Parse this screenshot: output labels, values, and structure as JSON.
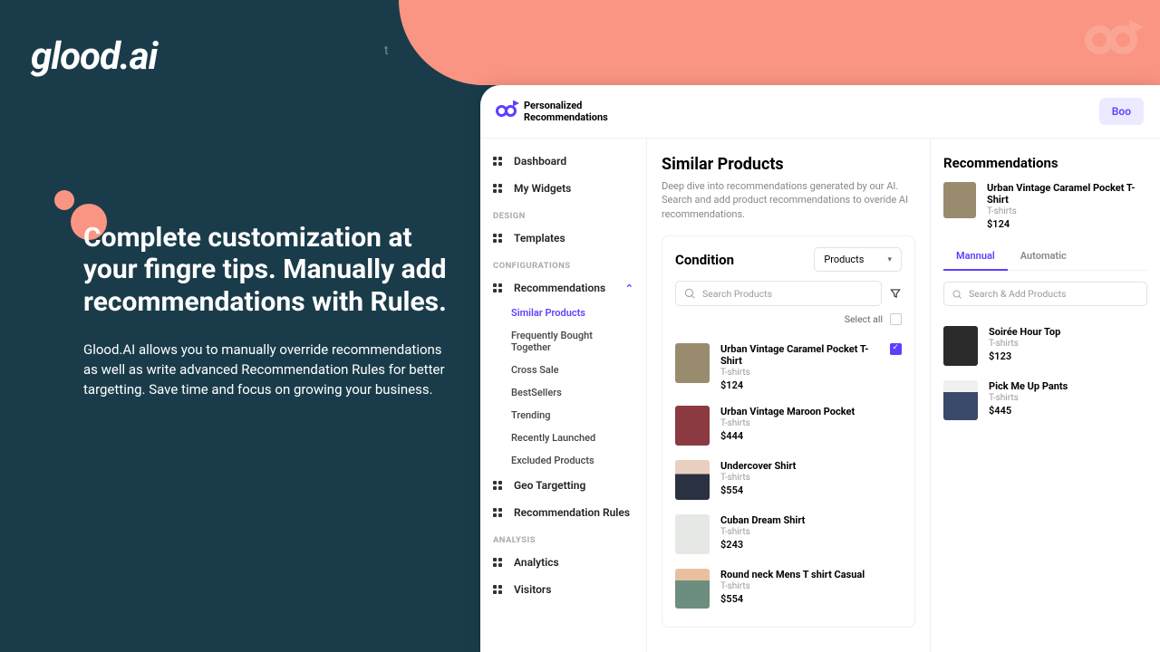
{
  "marketing": {
    "logo": "glood.ai",
    "stray_char": "t",
    "headline": "Complete customization at your fingre tips. Manually add recommendations with Rules.",
    "body": "Glood.AI allows you to manually override recommendations as well as write advanced Recommendation Rules for better targetting. Save time and focus on growing your business."
  },
  "app": {
    "header": {
      "title_line1": "Personalized",
      "title_line2": "Recommendations",
      "cta": "Boo"
    },
    "nav": {
      "items_top": [
        {
          "label": "Dashboard"
        },
        {
          "label": "My Widgets"
        }
      ],
      "section_design": "DESIGN",
      "design_items": [
        {
          "label": "Templates"
        }
      ],
      "section_config": "CONFIGURATIONS",
      "recommendations_label": "Recommendations",
      "rec_children": [
        {
          "label": "Similar Products",
          "active": true
        },
        {
          "label": "Frequently Bought Together"
        },
        {
          "label": "Cross Sale"
        },
        {
          "label": "BestSellers"
        },
        {
          "label": "Trending"
        },
        {
          "label": "Recently Launched"
        },
        {
          "label": "Excluded Products"
        }
      ],
      "config_items": [
        {
          "label": "Geo Targetting"
        },
        {
          "label": "Recommendation Rules"
        }
      ],
      "section_analysis": "ANALYSIS",
      "analysis_items": [
        {
          "label": "Analytics"
        },
        {
          "label": "Visitors"
        }
      ]
    },
    "page": {
      "title": "Similar Products",
      "description": "Deep dive into recommendations generated by our AI. Search and add product recommendations to overide AI recommendations.",
      "condition": {
        "title": "Condition",
        "select_label": "Products",
        "search_placeholder": "Search Products",
        "select_all": "Select all",
        "products": [
          {
            "name": "Urban Vintage Caramel Pocket T-Shirt",
            "cat": "T-shirts",
            "price": "$124",
            "checked": true,
            "cls": "c1"
          },
          {
            "name": "Urban Vintage Maroon Pocket",
            "cat": "T-shirts",
            "price": "$444",
            "cls": "c2"
          },
          {
            "name": "Undercover Shirt",
            "cat": "T-shirts",
            "price": "$554",
            "cls": "c3"
          },
          {
            "name": "Cuban Dream Shirt",
            "cat": "T-shirts",
            "price": "$243",
            "cls": "c4"
          },
          {
            "name": "Round neck Mens T shirt Casual",
            "cat": "T-shirts",
            "price": "$554",
            "cls": "c5"
          }
        ]
      },
      "recommendations": {
        "title": "Recommendations",
        "selected": {
          "name": "Urban Vintage Caramel Pocket T-Shirt",
          "cat": "T-shirts",
          "price": "$124",
          "cls": "c1"
        },
        "tabs": [
          {
            "label": "Mannual",
            "active": true
          },
          {
            "label": "Automatic"
          }
        ],
        "search_placeholder": "Search & Add Products",
        "items": [
          {
            "name": "Soirée Hour Top",
            "cat": "T-shirts",
            "price": "$123",
            "cls": "c6"
          },
          {
            "name": "Pick Me Up Pants",
            "cat": "T-shirts",
            "price": "$445",
            "cls": "c7"
          }
        ]
      }
    }
  }
}
